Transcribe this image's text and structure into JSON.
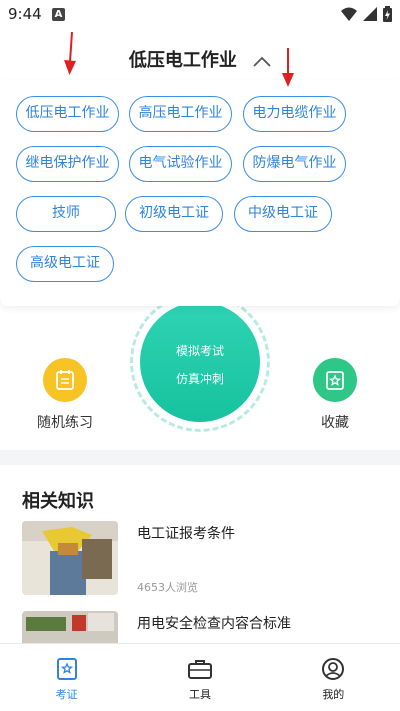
{
  "status_bar": {
    "time": "9:44",
    "notification_badge": "A"
  },
  "header": {
    "title": "低压电工作业",
    "toggle_icon": "chevron-up-icon"
  },
  "category_chips": [
    {
      "label": "低压电工作业"
    },
    {
      "label": "高压电工作业"
    },
    {
      "label": "电力电缆作业"
    },
    {
      "label": "继电保护作业"
    },
    {
      "label": "电气试验作业"
    },
    {
      "label": "防爆电气作业"
    },
    {
      "label": "技师"
    },
    {
      "label": "初级电工证"
    },
    {
      "label": "中级电工证"
    },
    {
      "label": "高级电工证"
    }
  ],
  "exam": {
    "line1": "模拟考试",
    "line2": "仿真冲刺"
  },
  "practice": {
    "label": "随机练习",
    "icon": "checklist-icon",
    "color": "#f7c325"
  },
  "favorites": {
    "label": "收藏",
    "icon": "star-icon",
    "color": "#2fc787"
  },
  "knowledge": {
    "title": "相关知识",
    "articles": [
      {
        "title": "电工证报考条件",
        "views": "4653人浏览"
      },
      {
        "title": "用电安全检查内容合标准",
        "views": ""
      }
    ]
  },
  "bottom_nav": [
    {
      "label": "考证",
      "icon": "certificate-icon",
      "active": true
    },
    {
      "label": "工具",
      "icon": "toolbox-icon",
      "active": false
    },
    {
      "label": "我的",
      "icon": "profile-icon",
      "active": false
    }
  ],
  "colors": {
    "accent": "#2f84de",
    "chip_border": "#3a8ee6",
    "exam_green": "#16c29f",
    "annotation_red": "#e02020"
  }
}
